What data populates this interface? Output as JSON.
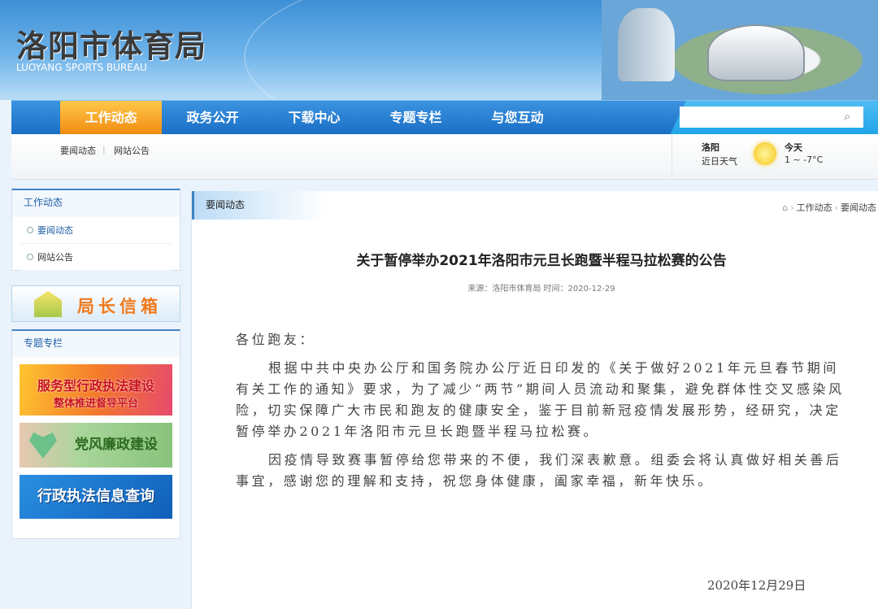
{
  "header": {
    "title": "洛阳市体育局",
    "subtitle": "LUOYANG SPORTS BUREAU"
  },
  "nav": {
    "items": [
      "工作动态",
      "政务公开",
      "下载中心",
      "专题专栏",
      "与您互动"
    ],
    "search_placeholder": ""
  },
  "subnav": {
    "links": [
      "要闻动态",
      "网站公告"
    ]
  },
  "weather": {
    "city": "洛阳",
    "label": "近日天气",
    "day": "今天",
    "temp": "1 ~ -7°C"
  },
  "sidebar": {
    "section1_title": "工作动态",
    "links": [
      "要闻动态",
      "网站公告"
    ],
    "mailbox": "局长信箱",
    "section2_title": "专题专栏",
    "banners": {
      "b1_line1": "服务型行政执法建设",
      "b1_line2": "整体推进督导平台",
      "b2": "党风廉政建设",
      "b3": "行政执法信息查询"
    }
  },
  "main": {
    "tab": "要闻动态",
    "breadcrumb": [
      "工作动态",
      "要闻动态"
    ],
    "title": "关于暂停举办2021年洛阳市元旦长跑暨半程马拉松赛的公告",
    "meta": "来源：洛阳市体育局  时间：2020-12-29",
    "greeting": "各位跑友：",
    "paragraphs": [
      "根据中共中央办公厅和国务院办公厅近日印发的《关于做好2021年元旦春节期间有关工作的通知》要求，为了减少“两节”期间人员流动和聚集，避免群体性交叉感染风险，切实保障广大市民和跑友的健康安全，鉴于目前新冠疫情发展形势，经研究，决定暂停举办2021年洛阳市元旦长跑暨半程马拉松赛。",
      "因疫情导致赛事暂停给您带来的不便，我们深表歉意。组委会将认真做好相关善后事宜，感谢您的理解和支持，祝您身体健康，阖家幸福，新年快乐。"
    ],
    "date": "2020年12月29日"
  }
}
